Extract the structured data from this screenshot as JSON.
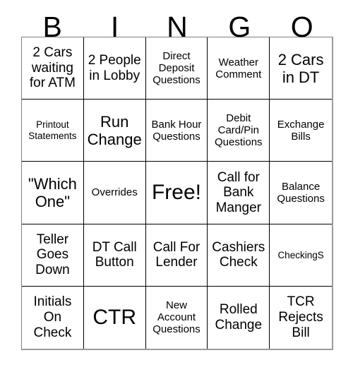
{
  "card": {
    "header": {
      "letters": [
        "B",
        "I",
        "N",
        "G",
        "O"
      ]
    },
    "colors": {
      "background": "#ffffff",
      "text": "#000000",
      "cell_border": "#000000",
      "outer_border": "#9a9a9a"
    },
    "grid": {
      "columns": 5,
      "rows": 5,
      "free_space_index": 12,
      "cells": [
        {
          "text": "2 Cars waiting for ATM",
          "size": "md"
        },
        {
          "text": "2 People in Lobby",
          "size": "md"
        },
        {
          "text": "Direct Deposit Questions",
          "size": "sm"
        },
        {
          "text": "Weather Comment",
          "size": "sm"
        },
        {
          "text": "2 Cars in DT",
          "size": "lg"
        },
        {
          "text": "Printout Statements",
          "size": "xs"
        },
        {
          "text": "Run Change",
          "size": "lg"
        },
        {
          "text": "Bank Hour Questions",
          "size": "sm"
        },
        {
          "text": "Debit Card/Pin Questions",
          "size": "sm"
        },
        {
          "text": "Exchange Bills",
          "size": "sm"
        },
        {
          "text": "\"Which One\"",
          "size": "lg"
        },
        {
          "text": "Overrides",
          "size": "sm"
        },
        {
          "text": "Free!",
          "size": "xl"
        },
        {
          "text": "Call for Bank Manger",
          "size": "md"
        },
        {
          "text": "Balance Questions",
          "size": "sm"
        },
        {
          "text": "Teller Goes Down",
          "size": "md"
        },
        {
          "text": "DT Call Button",
          "size": "md"
        },
        {
          "text": "Call For Lender",
          "size": "md"
        },
        {
          "text": "Cashiers Check",
          "size": "md"
        },
        {
          "text": "CheckingS",
          "size": "xs"
        },
        {
          "text": "Initials On Check",
          "size": "md"
        },
        {
          "text": "CTR",
          "size": "xl"
        },
        {
          "text": "New Account Questions",
          "size": "sm"
        },
        {
          "text": "Rolled Change",
          "size": "md"
        },
        {
          "text": "TCR Rejects Bill",
          "size": "md"
        }
      ]
    }
  }
}
